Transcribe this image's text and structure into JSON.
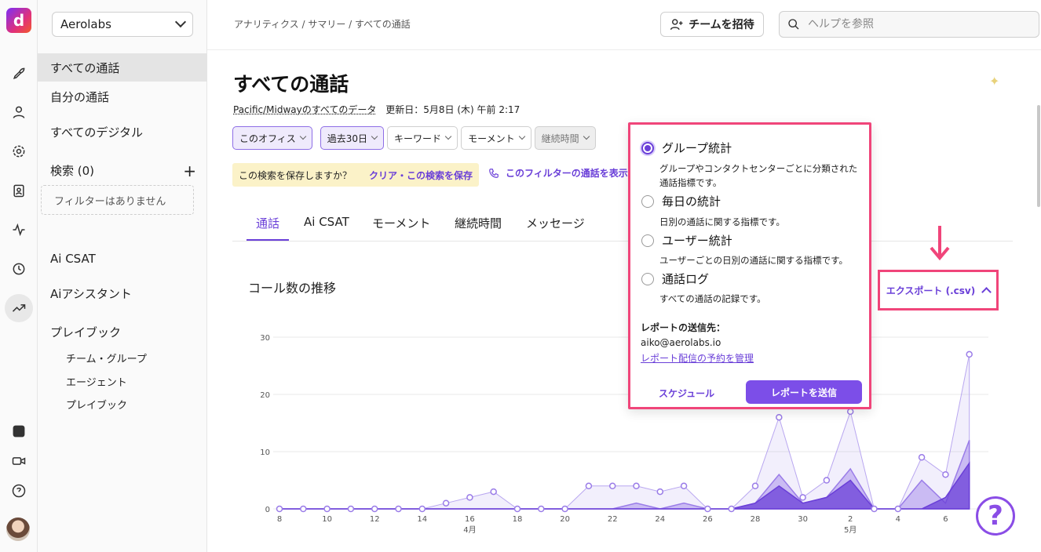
{
  "org": {
    "name": "Aerolabs"
  },
  "sidebar": {
    "links": [
      "すべての通話",
      "自分の通話",
      "すべてのデジタル"
    ],
    "search_label": "検索 (0)",
    "add_icon": "+",
    "no_filters": "フィルターはありません",
    "sections": [
      "Ai CSAT",
      "Aiアシスタント",
      "プレイブック"
    ],
    "sub_items": [
      "チーム・グループ",
      "エージェント",
      "プレイブック"
    ]
  },
  "topbar": {
    "breadcrumb": "アナリティクス / サマリー / すべての通話",
    "invite_label": "チームを招待",
    "help_placeholder": "ヘルプを参照"
  },
  "page": {
    "title": "すべての通話",
    "scope": "Pacific/Midwayのすべてのデータ",
    "updated": "更新日：5月8日 (木) 午前 2:17"
  },
  "filters": [
    "このオフィス",
    "過去30日",
    "キーワード",
    "モーメント",
    "継続時間"
  ],
  "save_bar": {
    "question": "この検索を保存しますか？",
    "action": "クリア・この検索を保存"
  },
  "call_filter_label": "このフィルターの通話を表示",
  "tabs": [
    "通話",
    "Ai CSAT",
    "モーメント",
    "継続時間",
    "メッセージ"
  ],
  "active_tab": 0,
  "chart_title": "コール数の推移",
  "export_label": "エクスポート (.csv)",
  "popup": {
    "options": [
      {
        "label": "グループ統計",
        "desc": "グループやコンタクトセンターごとに分類された通話指標です。",
        "selected": true
      },
      {
        "label": "毎日の統計",
        "desc": "日別の通話に関する指標です。",
        "selected": false
      },
      {
        "label": "ユーザー統計",
        "desc": "ユーザーごとの日別の通話に関する指標です。",
        "selected": false
      },
      {
        "label": "通話ログ",
        "desc": "すべての通話の記録です。",
        "selected": false
      }
    ],
    "recipient_label": "レポートの送信先：",
    "recipient_email": "aiko@aerolabs.io",
    "manage_link": "レポート配信の予約を管理",
    "schedule_label": "スケジュール",
    "send_label": "レポートを送信"
  },
  "help_fab": "?",
  "chart_data": {
    "type": "area",
    "x": [
      "4/8",
      "4/9",
      "4/10",
      "4/11",
      "4/12",
      "4/13",
      "4/14",
      "4/15",
      "4/16",
      "4/17",
      "4/18",
      "4/19",
      "4/20",
      "4/21",
      "4/22",
      "4/23",
      "4/24",
      "4/25",
      "4/26",
      "4/27",
      "4/28",
      "4/29",
      "4/30",
      "5/1",
      "5/2",
      "5/3",
      "5/4",
      "5/5",
      "5/6",
      "5/7"
    ],
    "x_tick_labels": [
      "8",
      "10",
      "12",
      "14",
      "16",
      "18",
      "20",
      "22",
      "24",
      "26",
      "28",
      "30",
      "2",
      "4",
      "6"
    ],
    "x_month_labels": [
      {
        "label": "4月",
        "tick": "16"
      },
      {
        "label": "5月",
        "tick": "2"
      }
    ],
    "y_ticks": [
      "0",
      "10",
      "20",
      "30"
    ],
    "ylim": [
      0,
      30
    ],
    "series": [
      {
        "values": [
          0,
          0,
          0,
          0,
          0,
          0,
          0,
          1,
          2,
          3,
          0,
          0,
          0,
          4,
          4,
          4,
          3,
          4,
          0,
          0,
          4,
          16,
          2,
          5,
          17,
          0,
          0,
          9,
          6,
          27
        ],
        "color": "#b9a7f0"
      },
      {
        "values": [
          0,
          0,
          0,
          0,
          0,
          0,
          0,
          0,
          0,
          0,
          0,
          0,
          0,
          0,
          0,
          1,
          0,
          1,
          0,
          0,
          1,
          6,
          1,
          2,
          7,
          0,
          0,
          5,
          1,
          12
        ],
        "color": "#9a7ce8"
      },
      {
        "values": [
          0,
          0,
          0,
          0,
          0,
          0,
          0,
          0,
          0,
          0,
          0,
          0,
          0,
          0,
          0,
          0,
          0,
          0,
          0,
          0,
          1,
          4,
          1,
          2,
          5,
          0,
          0,
          0,
          2,
          8
        ],
        "color": "#6a3fd8"
      }
    ],
    "grid": true
  }
}
